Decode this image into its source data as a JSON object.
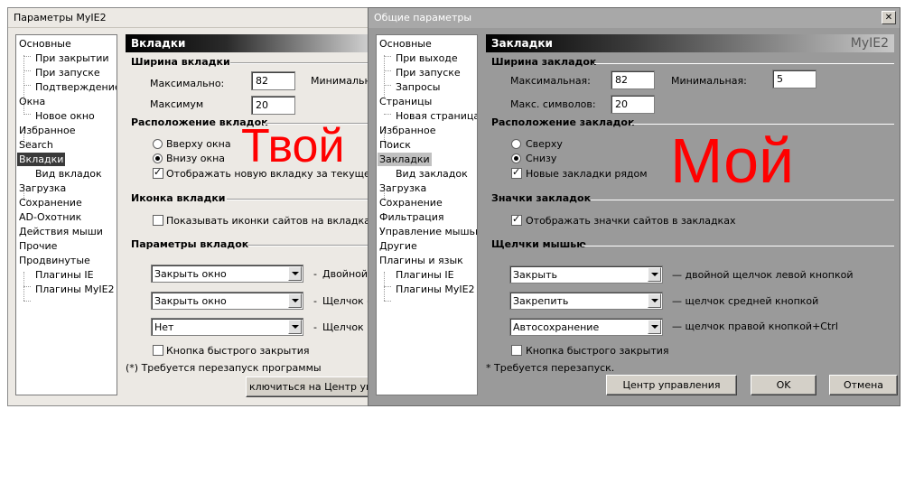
{
  "colors": {
    "accent_red": "#ff0000",
    "left_face": "#ece9e4",
    "right_face": "#9a9a9a"
  },
  "left_window": {
    "title": "Параметры MyIE2",
    "header": "Вкладки",
    "tree": [
      {
        "label": "Основные"
      },
      {
        "label": "При закрытии"
      },
      {
        "label": "При запуске"
      },
      {
        "label": "Подтверждение"
      },
      {
        "label": "Окна"
      },
      {
        "label": "Новое окно"
      },
      {
        "label": "Избранное"
      },
      {
        "label": "Search"
      },
      {
        "label": "Вкладки"
      },
      {
        "label": "Вид вкладок"
      },
      {
        "label": "Загрузка"
      },
      {
        "label": "Сохранение"
      },
      {
        "label": "AD-Охотник"
      },
      {
        "label": "Действия мыши"
      },
      {
        "label": "Прочие"
      },
      {
        "label": "Продвинутые"
      },
      {
        "label": "Плагины IE"
      },
      {
        "label": "Плагины MyIE2"
      }
    ],
    "width_group": "Ширина вкладки",
    "max_label": "Максимально:",
    "max_value": "82",
    "min_label": "Минимально",
    "maximum_label": "Максимум",
    "maximum_value": "20",
    "position_group": "Расположение вкладок",
    "radio_top": "Вверху окна",
    "radio_bottom": "Внизу окна",
    "check_new_tab": "Отображать новую вкладку за текущей",
    "icon_group": "Иконка вкладки",
    "check_icons": "Показывать иконки сайтов на вкладках",
    "params_group": "Параметры вкладок",
    "combo1": "Закрыть окно",
    "combo1_desc": "Двойной",
    "combo2": "Закрыть окно",
    "combo2_desc": "Щелчок с",
    "combo3": "Нет",
    "combo3_desc": "Щелчок п",
    "dash": "-",
    "check_close": "Кнопка быстрого закрытия",
    "note": "(*) Требуется перезапуск программы",
    "button_control": "ключиться на Центр упра"
  },
  "right_window": {
    "title": "Общие параметры",
    "close_symbol": "✕",
    "header": "Закладки",
    "brand": "MyIE2",
    "tree": [
      {
        "label": "Основные"
      },
      {
        "label": "При выходе"
      },
      {
        "label": "При запуске"
      },
      {
        "label": "Запросы"
      },
      {
        "label": "Страницы"
      },
      {
        "label": "Новая страница"
      },
      {
        "label": "Избранное"
      },
      {
        "label": "Поиск"
      },
      {
        "label": "Закладки"
      },
      {
        "label": "Вид закладок"
      },
      {
        "label": "Загрузка"
      },
      {
        "label": "Сохранение"
      },
      {
        "label": "Фильтрация"
      },
      {
        "label": "Управление мышью"
      },
      {
        "label": "Другие"
      },
      {
        "label": "Плагины и язык"
      },
      {
        "label": "Плагины IE"
      },
      {
        "label": "Плагины MyIE2"
      }
    ],
    "width_group": "Ширина закладок",
    "max_label": "Максимальная:",
    "max_value": "82",
    "min_label": "Минимальная:",
    "min_value": "5",
    "maxchars_label": "Макс. символов:",
    "maxchars_value": "20",
    "position_group": "Расположение закладок",
    "radio_top": "Сверху",
    "radio_bottom": "Снизу",
    "check_new_tab": "Новые закладки рядом",
    "icon_group": "Значки закладок",
    "check_icons": "Отображать значки сайтов в закладках",
    "clicks_group": "Щелчки мышью",
    "combo1": "Закрыть",
    "combo1_desc": "— двойной щелчок левой кнопкой",
    "combo2": "Закрепить",
    "combo2_desc": "— щелчок средней кнопкой",
    "combo3": "Автосохранение",
    "combo3_desc": "— щелчок правой кнопкой+Ctrl",
    "check_close": "Кнопка быстрого закрытия",
    "note": "* Требуется перезапуск.",
    "button_control": "Центр управления",
    "button_ok": "OK",
    "button_cancel": "Отмена"
  },
  "overlay": {
    "left_word": "Твой",
    "right_word": "Мой"
  }
}
